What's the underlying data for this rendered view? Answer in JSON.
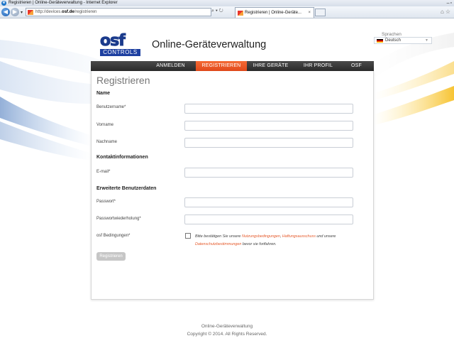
{
  "window": {
    "title": "Registrieren | Online-Geräteverwaltung - Internet Explorer"
  },
  "browser": {
    "url_prefix": "http://devices.",
    "url_domain": "osf.de",
    "url_path": "/registrieren",
    "tab_title": "Registrieren | Online-Geräte..."
  },
  "header": {
    "logo_letters": "osf",
    "logo_subtitle": "CONTROLS",
    "site_title": "Online-Geräteverwaltung",
    "language_label": "Sprachen",
    "language_value": "Deutsch"
  },
  "menu": {
    "items": [
      {
        "label": "ANMELDEN",
        "active": false
      },
      {
        "label": "REGISTRIEREN",
        "active": true
      },
      {
        "label": "IHRE GERÄTE",
        "active": false
      },
      {
        "label": "IHR PROFIL",
        "active": false
      },
      {
        "label": "OSF",
        "active": false
      }
    ]
  },
  "form": {
    "title": "Registrieren",
    "section_name": "Name",
    "username_label": "Benutzername*",
    "firstname_label": "Vorname",
    "lastname_label": "Nachname",
    "section_contact": "Kontaktinformationen",
    "email_label": "E-mail*",
    "section_extended": "Erweiterte Benutzerdaten",
    "password_label": "Passwort*",
    "password_repeat_label": "Passwortwiederholung*",
    "terms_label": "osf Bedingungen*",
    "terms_text_1": "Bitte bestätigen Sie unsere ",
    "terms_link_1": "Nutzungsbedingungen",
    "terms_text_2": ", ",
    "terms_link_2": "Haftungsausschuss",
    "terms_text_3": " und unsere ",
    "terms_link_3": "Datenschutzbestimmungen",
    "terms_text_4": " bevor sie fortfahren.",
    "submit_label": "Registrieren"
  },
  "footer": {
    "line1": "Online-Geräteverwaltung",
    "line2": "Copyright © 2014. All Rights Reserved."
  },
  "colors": {
    "accent": "#e24a1b",
    "menu_bg": "#333333",
    "logo_blue": "#1d3fa0"
  }
}
